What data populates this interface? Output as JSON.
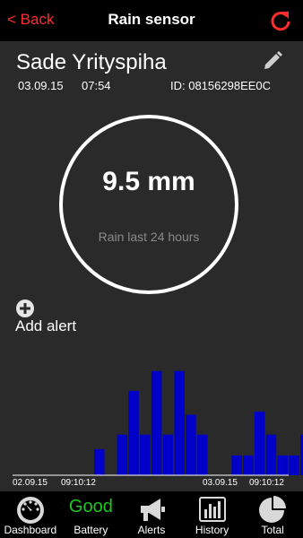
{
  "nav": {
    "back_label": "< Back",
    "title": "Rain sensor"
  },
  "sensor": {
    "name": "Sade Yrityspiha",
    "date": "03.09.15",
    "time": "07:54",
    "id_text": "ID: 08156298EE0C"
  },
  "reading": {
    "value": "9.5 mm",
    "label": "Rain last 24 hours"
  },
  "alert": {
    "add_label": "Add alert"
  },
  "chart_data": {
    "type": "bar",
    "x_labels": [
      {
        "date": "02.09.15",
        "time": "09:10:12"
      },
      {
        "date": "03.09.15",
        "time": "09:10:12"
      }
    ],
    "values": [
      0,
      0,
      0,
      0,
      0,
      0,
      0,
      0,
      2.5,
      0,
      3.9,
      8.1,
      3.9,
      10,
      3.9,
      10,
      5.8,
      3.9,
      0,
      0,
      1.9,
      1.9,
      6.1,
      3.9,
      1.9,
      1.9,
      3.9
    ],
    "bar_color": "#0000c8",
    "baseline_color": "#ffffff",
    "ylim": [
      0,
      10.5
    ],
    "title": "",
    "xlabel": "",
    "ylabel": ""
  },
  "tabs": [
    {
      "label": "Dashboard",
      "icon": "gauge-icon"
    },
    {
      "label": "Battery",
      "icon_text": "Good"
    },
    {
      "label": "Alerts",
      "icon": "megaphone-icon"
    },
    {
      "label": "History",
      "icon": "bar-chart-icon"
    },
    {
      "label": "Total",
      "icon": "pie-chart-icon"
    }
  ],
  "colors": {
    "accent": "#ff2d2d",
    "battery_good": "#21c421",
    "background": "#2a2a2a"
  }
}
